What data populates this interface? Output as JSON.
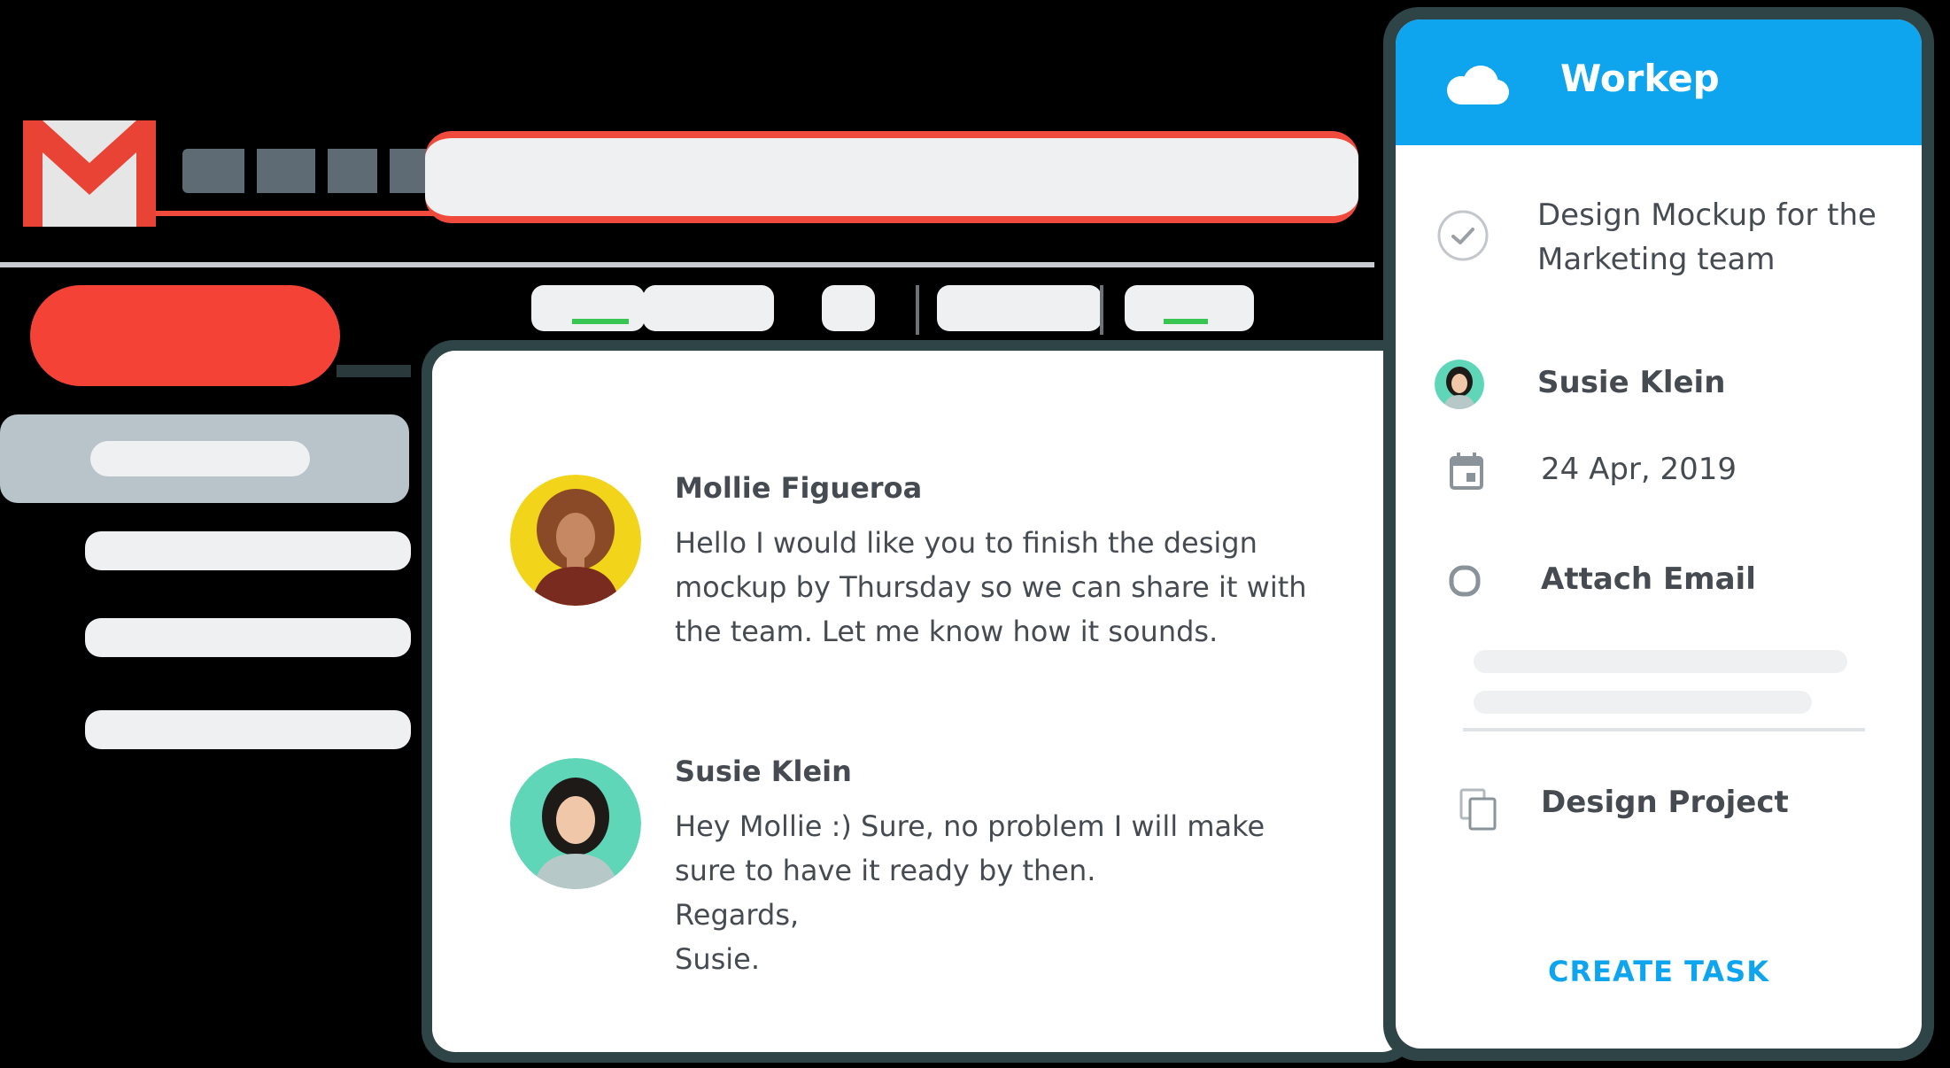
{
  "gmail": {
    "logo_icon": "gmail-m-icon",
    "brand_color": "#f44336",
    "background": "#000000"
  },
  "email_thread": {
    "messages": [
      {
        "author": "Mollie Figueroa",
        "body": "Hello I would like you to finish the design\nmockup by Thursday so we can share it with\nthe team. Let me know how it sounds."
      },
      {
        "author": "Susie Klein",
        "body": "Hey Mollie :) Sure, no problem I will make\nsure to have it ready by then.\nRegards,\nSusie."
      }
    ]
  },
  "workep": {
    "app_title": "Workep",
    "header_color": "#0fa4ee",
    "task_title": "Design Mockup for the Marketing team",
    "assignee": "Susie Klein",
    "due_date": "24 Apr, 2019",
    "attach_label": "Attach Email",
    "project": "Design Project",
    "create_button": "CREATE TASK",
    "icons": [
      "cloud-icon",
      "check-circle-icon",
      "calendar-icon",
      "circle-icon",
      "copy-icon"
    ]
  }
}
